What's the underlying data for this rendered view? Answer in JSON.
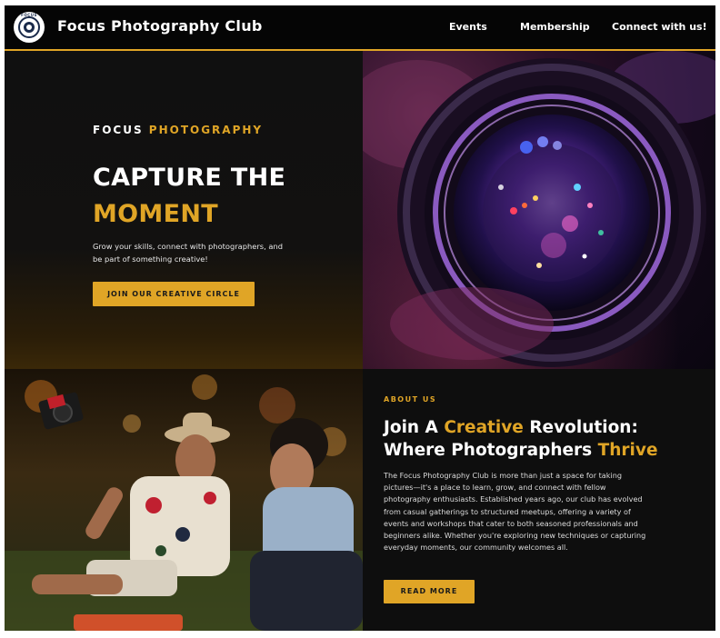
{
  "header": {
    "logo_text": "FOCUS",
    "brand": "Focus Photography Club",
    "nav": [
      "Events",
      "Membership",
      "Connect with us!"
    ]
  },
  "hero": {
    "eyebrow_1": "FOCUS",
    "eyebrow_2": "PHOTOGRAPHY",
    "title_1": "CAPTURE THE",
    "title_2": "MOMENT",
    "subtitle": "Grow your skills, connect with photographers, and be part of something creative!",
    "cta": "JOIN OUR CREATIVE CIRCLE",
    "image": "camera-lens-photo"
  },
  "about": {
    "label": "ABOUT US",
    "heading_1": "Join A",
    "heading_2": "Creative",
    "heading_3": "Revolution:",
    "heading_4": "Where Photographers",
    "heading_5": "Thrive",
    "body": "The Focus Photography Club is more than just a space for taking pictures—it's a place to learn, grow, and connect with fellow photography enthusiasts. Established years ago, our club has evolved from casual gatherings to structured meetups, offering a variety of events and workshops that cater to both seasoned professionals and beginners alike. Whether you're exploring new techniques or capturing everyday moments, our community welcomes all.",
    "cta": "READ MORE",
    "image": "two-photographers-photo"
  },
  "colors": {
    "accent": "#e0a526",
    "background": "#0c0c0c"
  }
}
